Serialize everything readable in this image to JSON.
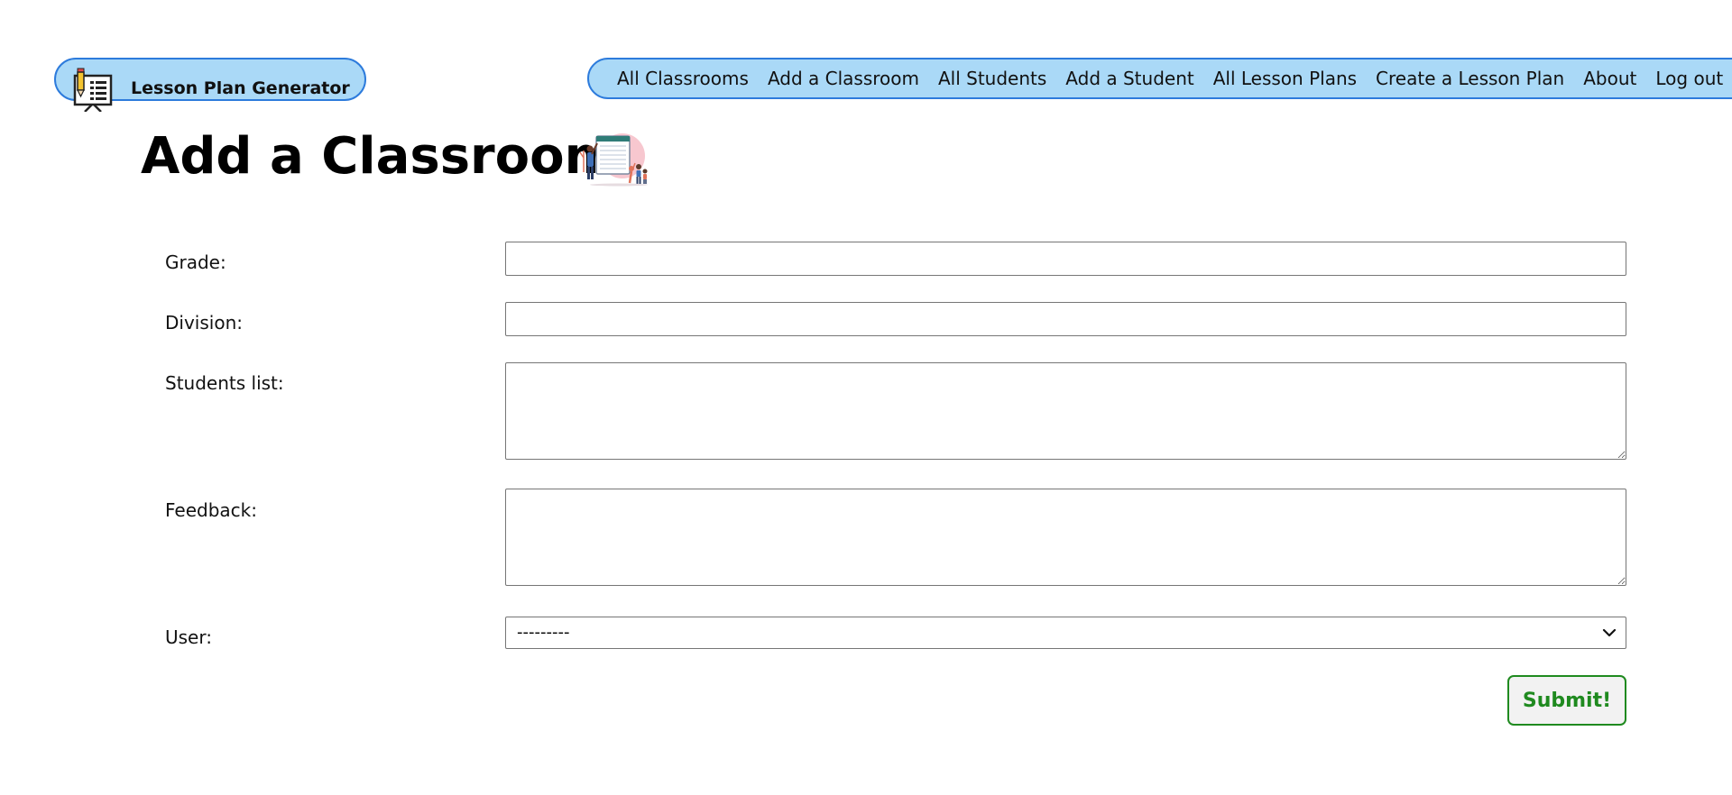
{
  "brand": {
    "title": "Lesson Plan Generator",
    "icon": "lesson-board-icon"
  },
  "nav": {
    "items": [
      {
        "label": "All Classrooms"
      },
      {
        "label": "Add a Classroom"
      },
      {
        "label": "All Students"
      },
      {
        "label": "Add a Student"
      },
      {
        "label": "All Lesson Plans"
      },
      {
        "label": "Create a Lesson Plan"
      },
      {
        "label": "About"
      },
      {
        "label": "Log out"
      }
    ]
  },
  "page": {
    "title": "Add a Classroom",
    "illustration": "classroom-illustration"
  },
  "form": {
    "grade": {
      "label": "Grade:",
      "value": ""
    },
    "division": {
      "label": "Division:",
      "value": ""
    },
    "students_list": {
      "label": "Students list:",
      "value": ""
    },
    "feedback": {
      "label": "Feedback:",
      "value": ""
    },
    "user": {
      "label": "User:",
      "selected": "---------"
    },
    "submit_label": "Submit!"
  },
  "colors": {
    "pill_background": "#aad9f7",
    "pill_border": "#2d7bdc",
    "submit_green": "#1f8a1f"
  }
}
